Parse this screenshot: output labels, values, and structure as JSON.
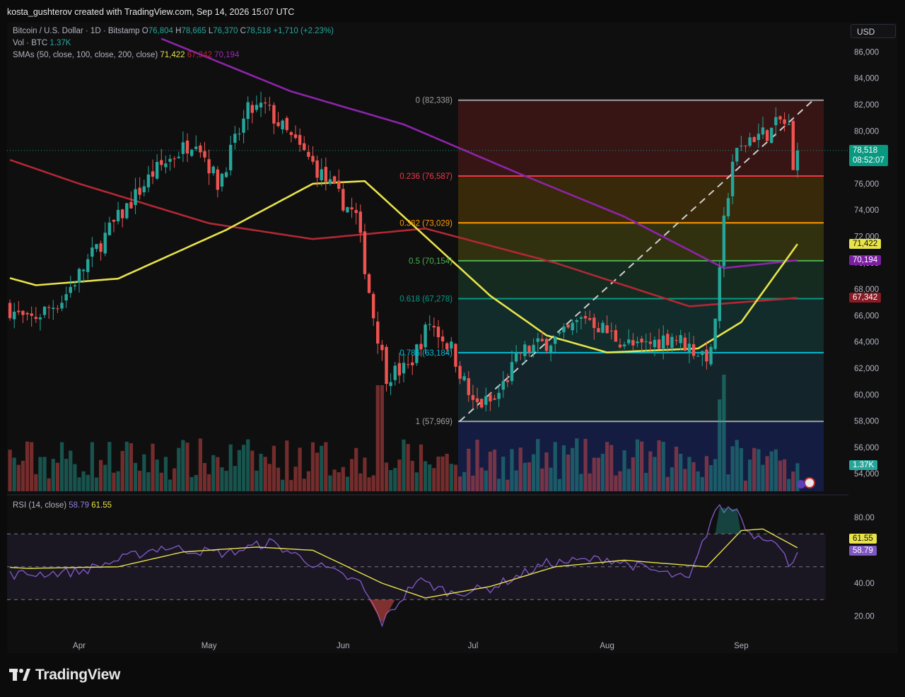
{
  "header": {
    "attribution": "kosta_gushterov created with TradingView.com, Sep 14, 2026 15:07 UTC"
  },
  "legend": {
    "symbol": "Bitcoin / U.S. Dollar · 1D · Bitstamp",
    "o_label": "O",
    "o_value": "76,804",
    "h_label": "H",
    "h_value": "78,665",
    "l_label": "L",
    "l_value": "76,370",
    "c_label": "C",
    "c_value": "78,518",
    "change": "+1,710 (+2.23%)",
    "vol_label": "Vol · BTC",
    "vol_value": "1.37K",
    "sma_label": "SMAs (50, close, 100, close, 200, close)",
    "sma50": "71,422",
    "sma100": "67,342",
    "sma200": "70,194",
    "rsi_label": "RSI (14, close)",
    "rsi_value": "58.79",
    "rsi_ma": "61.55"
  },
  "toolbar": {
    "currency": "USD"
  },
  "price_axis": {
    "ticks": [
      "86,000",
      "84,000",
      "82,000",
      "80,000",
      "78,000",
      "76,000",
      "74,000",
      "72,000",
      "70,000",
      "68,000",
      "66,000",
      "64,000",
      "62,000",
      "60,000",
      "58,000",
      "56,000",
      "54,000"
    ],
    "price_tag": "78,518",
    "countdown": "08:52:07",
    "sma50_tag": "71,422",
    "sma200_tag": "70,194",
    "sma100_tag": "67,342",
    "vol_tag": "1.37K"
  },
  "rsi_axis": {
    "ticks": [
      "80.00",
      "60.00",
      "40.00",
      "20.00"
    ],
    "ma_tag": "61.55",
    "rsi_tag": "58.79"
  },
  "time_axis": {
    "labels": [
      "Apr",
      "May",
      "Jun",
      "Jul",
      "Aug",
      "Sep"
    ]
  },
  "fib_levels": [
    {
      "label": "0 (82,338)",
      "price": 82338,
      "color": "#9e9e9e"
    },
    {
      "label": "0.236 (76,587)",
      "price": 76587,
      "color": "#f23645"
    },
    {
      "label": "0.382 (73,029)",
      "price": 73029,
      "color": "#ff9800"
    },
    {
      "label": "0.5 (70,154)",
      "price": 70154,
      "color": "#4caf50"
    },
    {
      "label": "0.618 (67,278)",
      "price": 67278,
      "color": "#089981"
    },
    {
      "label": "0.786 (63,184)",
      "price": 63184,
      "color": "#00bcd4"
    },
    {
      "label": "1 (57,969)",
      "price": 57969,
      "color": "#9e9e9e"
    }
  ],
  "colors": {
    "up": "#26a69a",
    "down": "#ef5350",
    "sma50": "#e8e34a",
    "sma100": "#b22833",
    "sma200": "#8e24aa",
    "rsi": "#7e57c2",
    "rsi_ma": "#e8e34a"
  },
  "brand": {
    "wordmark": "TradingView",
    "logo_icon": "tradingview-logo-icon"
  },
  "chart_data": {
    "type": "candlestick",
    "instrument": "Bitcoin / U.S. Dollar",
    "interval": "1D",
    "exchange": "Bitstamp",
    "last_close": 78518,
    "ylim": [
      53000,
      87000
    ],
    "waypoints_close": [
      [
        "Mar 1",
        71500
      ],
      [
        "Mar 6",
        72200
      ],
      [
        "Mar 12",
        67500
      ],
      [
        "Mar 20",
        65500
      ],
      [
        "Mar 28",
        67200
      ],
      [
        "Apr 8",
        72500
      ],
      [
        "Apr 18",
        76800
      ],
      [
        "Apr 28",
        79500
      ],
      [
        "May 3",
        76000
      ],
      [
        "May 10",
        81500
      ],
      [
        "May 14",
        81800
      ],
      [
        "May 19",
        79800
      ],
      [
        "May 25",
        77500
      ],
      [
        "May 31",
        75000
      ],
      [
        "Jun 4",
        73500
      ],
      [
        "Jun 8",
        66000
      ],
      [
        "Jun 11",
        61500
      ],
      [
        "Jun 16",
        62000
      ],
      [
        "Jun 21",
        65500
      ],
      [
        "Jun 26",
        63500
      ],
      [
        "Jul 1",
        59200
      ],
      [
        "Jul 6",
        59500
      ],
      [
        "Jul 12",
        63200
      ],
      [
        "Jul 22",
        64500
      ],
      [
        "Jul 27",
        66000
      ],
      [
        "Aug 2",
        64500
      ],
      [
        "Aug 8",
        63500
      ],
      [
        "Aug 16",
        64500
      ],
      [
        "Aug 22",
        63200
      ],
      [
        "Aug 25",
        63000
      ],
      [
        "Aug 27",
        69000
      ],
      [
        "Aug 28",
        73000
      ],
      [
        "Aug 30",
        77800
      ],
      [
        "Sep 3",
        79500
      ],
      [
        "Sep 8",
        80000
      ],
      [
        "Sep 10",
        80800
      ],
      [
        "Sep 12",
        80200
      ],
      [
        "Sep 13",
        76800
      ],
      [
        "Sep 14",
        78518
      ]
    ],
    "sma50_waypoints": [
      [
        "Mar 1",
        70200
      ],
      [
        "Mar 22",
        68300
      ],
      [
        "Apr 10",
        68800
      ],
      [
        "May 5",
        72500
      ],
      [
        "May 25",
        76000
      ],
      [
        "Jun 6",
        76200
      ],
      [
        "Jun 20",
        72000
      ],
      [
        "Jul 5",
        67500
      ],
      [
        "Jul 18",
        64500
      ],
      [
        "Aug 1",
        63200
      ],
      [
        "Aug 22",
        63500
      ],
      [
        "Sep 1",
        65500
      ],
      [
        "Sep 14",
        71422
      ]
    ],
    "sma100_waypoints": [
      [
        "Mar 1",
        79500
      ],
      [
        "Apr 1",
        76000
      ],
      [
        "May 1",
        73000
      ],
      [
        "May 25",
        71800
      ],
      [
        "Jun 20",
        72600
      ],
      [
        "Jul 20",
        70000
      ],
      [
        "Aug 20",
        66700
      ],
      [
        "Sep 14",
        67342
      ]
    ],
    "sma200_waypoints": [
      [
        "Apr 20",
        87000
      ],
      [
        "May 20",
        83000
      ],
      [
        "Jun 15",
        80500
      ],
      [
        "Jul 10",
        77000
      ],
      [
        "Aug 5",
        73500
      ],
      [
        "Aug 28",
        69600
      ],
      [
        "Sep 14",
        70194
      ]
    ],
    "rsi": {
      "value": 58.79,
      "ma": 61.55,
      "bands": [
        70,
        50,
        30
      ],
      "ylim": [
        10,
        90
      ]
    },
    "fibonacci": {
      "high": 82338,
      "low": 57969
    },
    "volume_last": "1.37K",
    "x_labels": [
      "Apr",
      "May",
      "Jun",
      "Jul",
      "Aug",
      "Sep"
    ]
  }
}
